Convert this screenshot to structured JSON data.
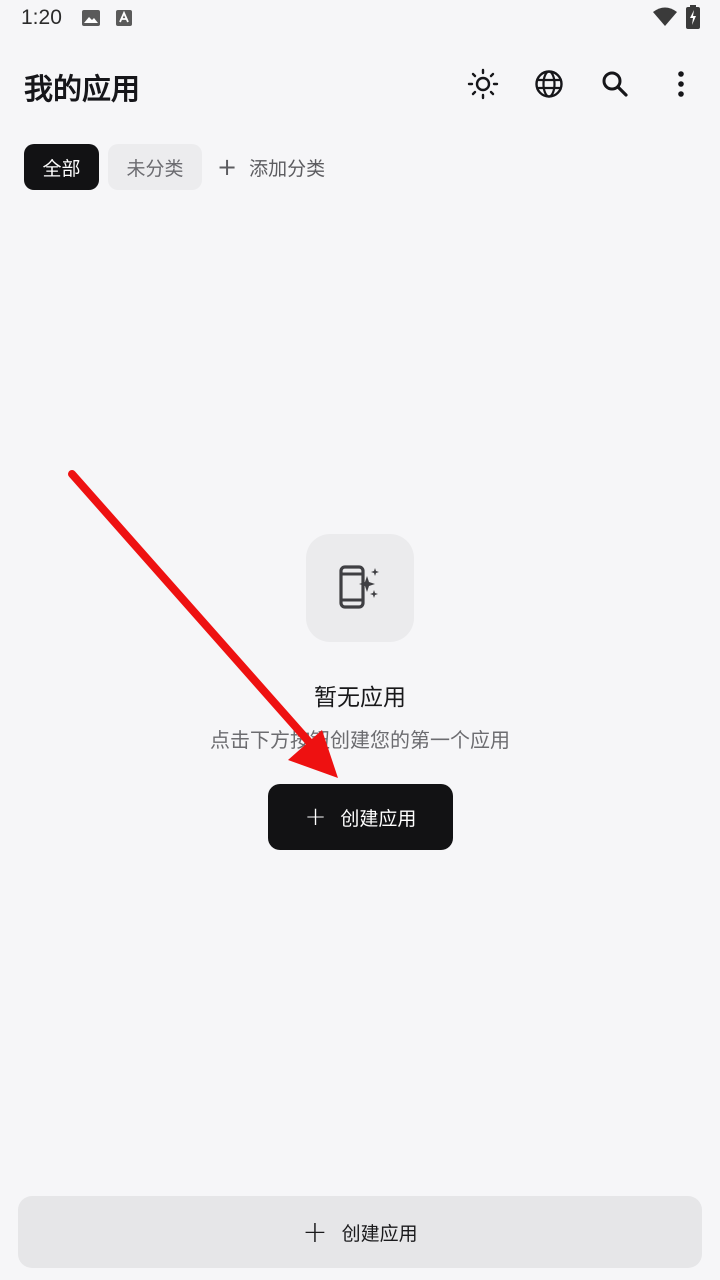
{
  "status_bar": {
    "time": "1:20",
    "icons": [
      "image-icon",
      "text-a-icon",
      "wifi-icon",
      "battery-charging-icon"
    ]
  },
  "app_bar": {
    "title": "我的应用",
    "actions": [
      "brightness-icon",
      "globe-icon",
      "search-icon",
      "more-vert-icon"
    ]
  },
  "tabs": {
    "all": "全部",
    "uncategorized": "未分类",
    "add": "添加分类",
    "add_icon": "+"
  },
  "empty_state": {
    "icon": "phone-sparkle-icon",
    "title": "暂无应用",
    "description": "点击下方按钮创建您的第一个应用",
    "button_label": "创建应用",
    "button_icon": "+"
  },
  "bottom_bar": {
    "button_label": "创建应用",
    "button_icon": "+"
  },
  "colors": {
    "background": "#f6f6f8",
    "primary_button": "#121214",
    "annotation_arrow": "#ee1111"
  }
}
